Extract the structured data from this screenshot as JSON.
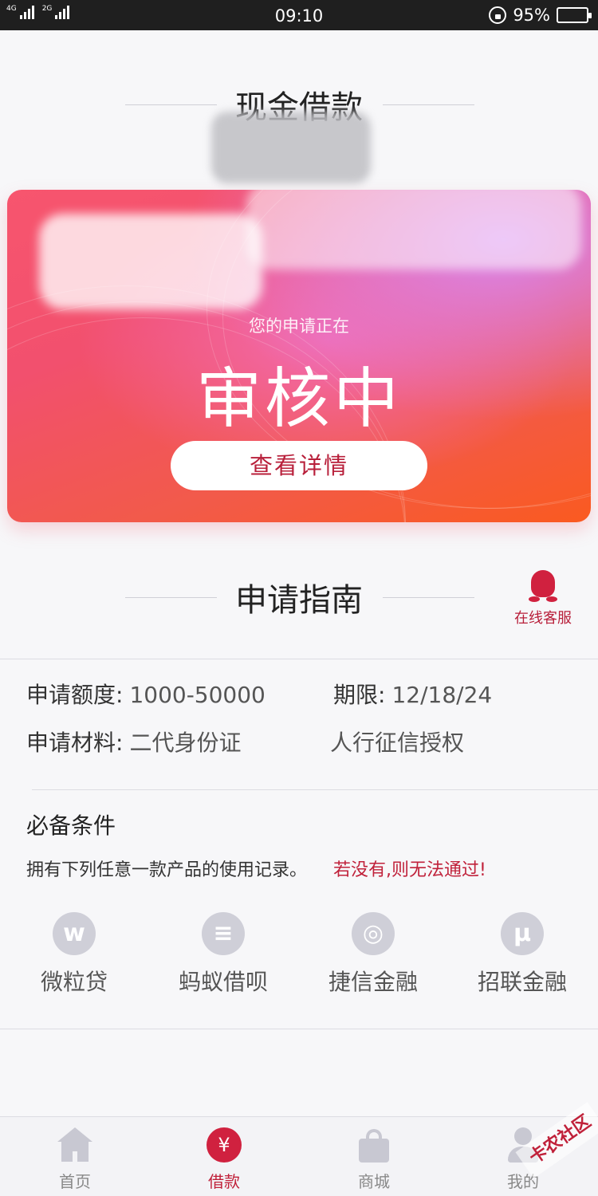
{
  "status_bar": {
    "network_1": "4G",
    "network_2": "2G",
    "time": "09:10",
    "battery_percent": "95%",
    "battery_level": 0.95
  },
  "header": {
    "title": "现金借款"
  },
  "status_card": {
    "subtitle": "您的申请正在",
    "status": "审核中",
    "detail_button": "查看详情",
    "colors": {
      "start": "#f7556e",
      "mid": "#f26bb0",
      "end": "#fa5a20",
      "button_text": "#b81f3a"
    }
  },
  "guide": {
    "title": "申请指南",
    "customer_service": "在线客服"
  },
  "info": {
    "amount_label": "申请额度:",
    "amount_value": "1000-50000",
    "term_label": "期限:",
    "term_value": "12/18/24",
    "materials_label": "申请材料:",
    "material_1": "二代身份证",
    "material_2": "人行征信授权"
  },
  "requirements": {
    "title": "必备条件",
    "description": "拥有下列任意一款产品的使用记录。",
    "warning": "若没有,则无法通过!",
    "products": [
      {
        "name": "微粒贷",
        "icon": "weilidai-icon",
        "glyph": "w"
      },
      {
        "name": "蚂蚁借呗",
        "icon": "ant-jiebei-icon",
        "glyph": "≡"
      },
      {
        "name": "捷信金融",
        "icon": "jiexin-icon",
        "glyph": "◎"
      },
      {
        "name": "招联金融",
        "icon": "zhaolian-icon",
        "glyph": "μ"
      }
    ]
  },
  "tab_bar": {
    "tabs": [
      {
        "label": "首页",
        "icon": "home-icon",
        "active": false
      },
      {
        "label": "借款",
        "icon": "yen-icon",
        "glyph": "¥",
        "active": true
      },
      {
        "label": "商城",
        "icon": "shopping-bag-icon",
        "active": false
      },
      {
        "label": "我的",
        "icon": "user-icon",
        "active": false
      }
    ],
    "active_color": "#c0213a"
  },
  "watermark": "卡农社区"
}
